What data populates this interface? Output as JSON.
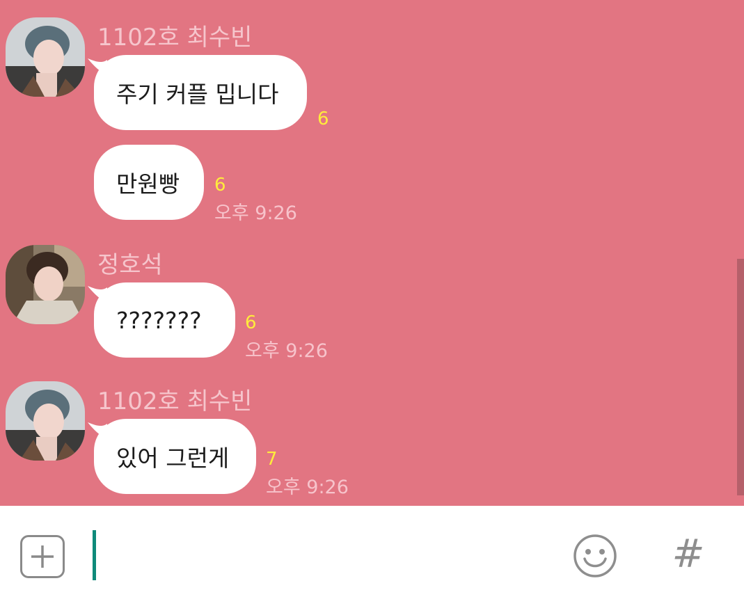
{
  "colors": {
    "chat_background": "#e27582",
    "bubble": "#ffffff",
    "unread_count": "#ffec3c",
    "sender_name": "#f6c5cc",
    "cursor": "#0f8a7a"
  },
  "messages": [
    {
      "sender": "1102호 최수빈",
      "avatar_icon": "profile-photo-avatar",
      "bubbles": [
        {
          "text": "주기 커플 밉니다",
          "unread": "6",
          "time": ""
        },
        {
          "text": "만원빵",
          "unread": "6",
          "time": "오후 9:26"
        }
      ]
    },
    {
      "sender": "정호석",
      "avatar_icon": "profile-photo-avatar",
      "bubbles": [
        {
          "text": "???????",
          "unread": "6",
          "time": "오후 9:26"
        }
      ]
    },
    {
      "sender": "1102호 최수빈",
      "avatar_icon": "profile-photo-avatar",
      "bubbles": [
        {
          "text": "있어 그런게",
          "unread": "7",
          "time": "오후 9:26"
        }
      ]
    }
  ],
  "input_bar": {
    "add_icon": "plus-icon",
    "emoji_icon": "smiley-icon",
    "hash_label": "#"
  }
}
